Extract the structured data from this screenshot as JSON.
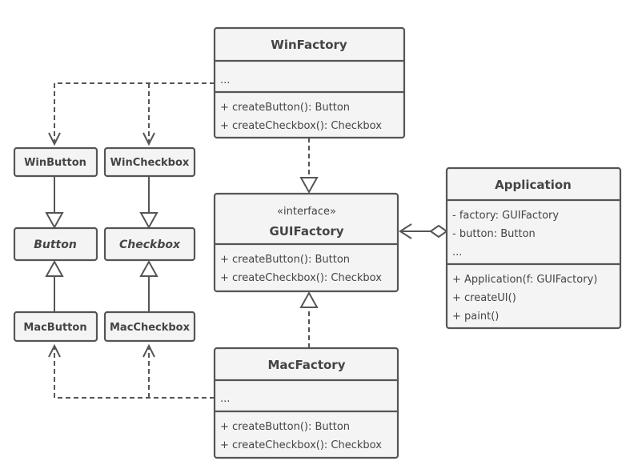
{
  "colors": {
    "stroke": "#555555",
    "fill": "#f4f4f4",
    "text": "#444444"
  },
  "classes": {
    "win_factory": {
      "name": "WinFactory",
      "fields": [
        "..."
      ],
      "methods": [
        "+ createButton(): Button",
        "+ createCheckbox(): Checkbox"
      ]
    },
    "gui_factory": {
      "stereotype": "«interface»",
      "name": "GUIFactory",
      "methods": [
        "+ createButton(): Button",
        "+ createCheckbox(): Checkbox"
      ]
    },
    "mac_factory": {
      "name": "MacFactory",
      "fields": [
        "..."
      ],
      "methods": [
        "+ createButton(): Button",
        "+ createCheckbox(): Checkbox"
      ]
    },
    "application": {
      "name": "Application",
      "fields": [
        "- factory: GUIFactory",
        "- button: Button",
        "..."
      ],
      "methods": [
        "+ Application(f: GUIFactory)",
        "+ createUI()",
        "+ paint()"
      ]
    },
    "win_button": {
      "name": "WinButton"
    },
    "win_checkbox": {
      "name": "WinCheckbox"
    },
    "button": {
      "name": "Button"
    },
    "checkbox": {
      "name": "Checkbox"
    },
    "mac_button": {
      "name": "MacButton"
    },
    "mac_checkbox": {
      "name": "MacCheckbox"
    }
  }
}
